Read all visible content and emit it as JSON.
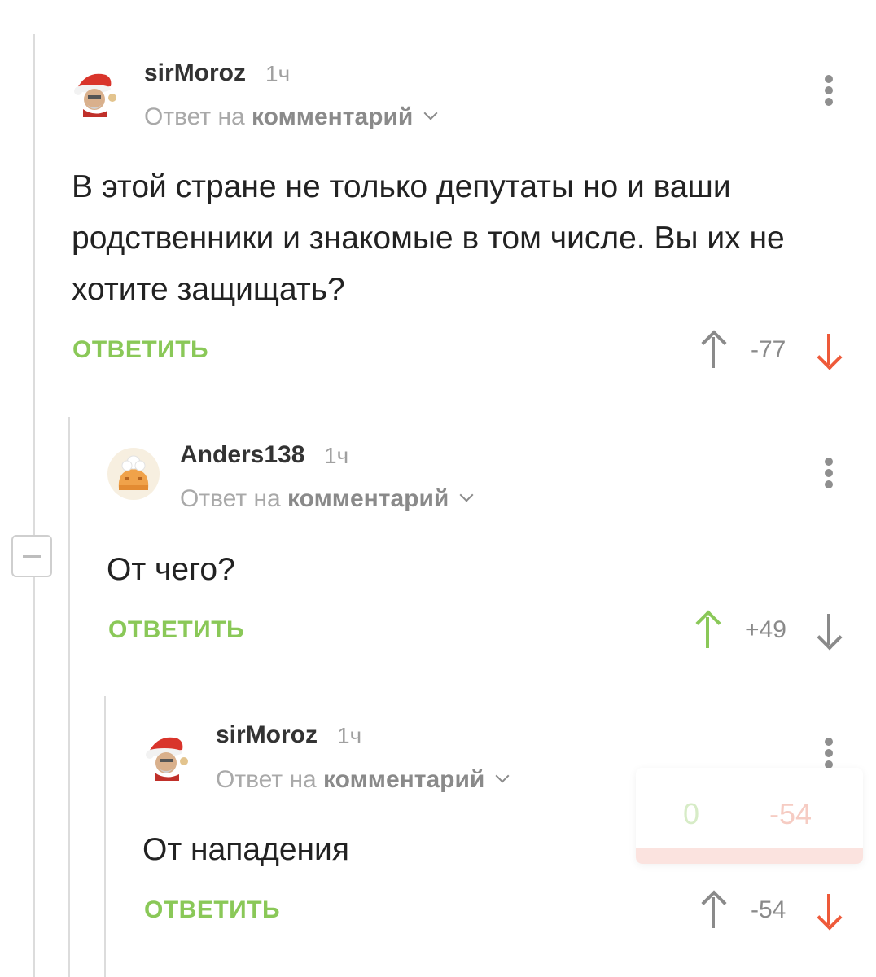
{
  "colors": {
    "accent_green": "#8ac858",
    "downvote_red": "#ee5a3a",
    "muted": "#8a8a8a"
  },
  "comments": [
    {
      "username": "sirMoroz",
      "time": "1ч",
      "reply_prefix": "Ответ на",
      "reply_target": "комментарий",
      "body": "В этой стране не только депутаты но и ваши родственники и знакомые в том числе. Вы их не хотите защищать?",
      "reply_label": "ОТВЕТИТЬ",
      "score": "-77",
      "avatar_icon": "santa-avatar-icon"
    },
    {
      "username": "Anders138",
      "time": "1ч",
      "reply_prefix": "Ответ на",
      "reply_target": "комментарий",
      "body": "От чего?",
      "reply_label": "ОТВЕТИТЬ",
      "score": "+49",
      "avatar_icon": "cook-avatar-icon"
    },
    {
      "username": "sirMoroz",
      "time": "1ч",
      "reply_prefix": "Ответ на",
      "reply_target": "комментарий",
      "body": "От нападения",
      "reply_label": "ОТВЕТИТЬ",
      "score": "-54",
      "avatar_icon": "santa-avatar-icon"
    }
  ],
  "vote_popup": {
    "plus": "0",
    "minus": "-54"
  }
}
